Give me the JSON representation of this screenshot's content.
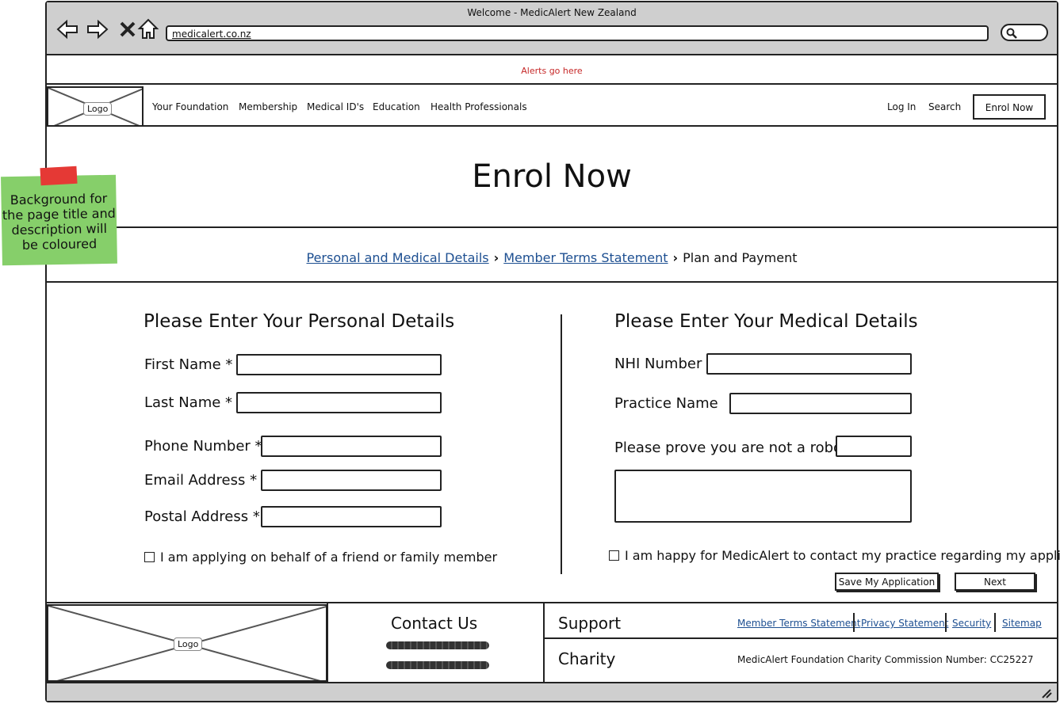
{
  "browser": {
    "window_title": "Welcome - MedicAlert New Zealand",
    "url": "medicalert.co.nz"
  },
  "alerts_text": "Alerts go here",
  "header": {
    "logo_label": "Logo",
    "nav": [
      "Your Foundation",
      "Membership",
      "Medical ID's",
      "Education",
      "Health Professionals"
    ],
    "login": "Log In",
    "search": "Search",
    "enrol_button": "Enrol Now"
  },
  "hero": {
    "title": "Enrol Now"
  },
  "sticky_note": "Background for the page title and description will be coloured",
  "breadcrumb": {
    "step1": "Personal and Medical Details",
    "step2": "Member Terms Statement",
    "step3": "Plan and Payment"
  },
  "personal": {
    "heading": "Please Enter Your Personal Details",
    "first_name": "First Name *",
    "last_name": "Last Name *",
    "phone": "Phone Number *",
    "email": "Email Address *",
    "postal": "Postal Address *",
    "behalf_checkbox": "I am applying on behalf of a friend or family member"
  },
  "medical": {
    "heading": "Please Enter Your Medical Details",
    "nhi": "NHI Number",
    "practice": "Practice Name",
    "robot": "Please prove you are not a robot:",
    "contact_checkbox": "I am happy for MedicAlert to contact my practice regarding my application"
  },
  "actions": {
    "save": "Save My Application",
    "next": "Next"
  },
  "footer": {
    "logo_label": "Logo",
    "contact_heading": "Contact Us",
    "support_heading": "Support",
    "support_links": [
      "Member Terms Statement",
      "Privacy Statement",
      "Security",
      "Sitemap"
    ],
    "charity_heading": "Charity",
    "charity_text": "MedicAlert Foundation Charity Commission Number: CC25227"
  }
}
